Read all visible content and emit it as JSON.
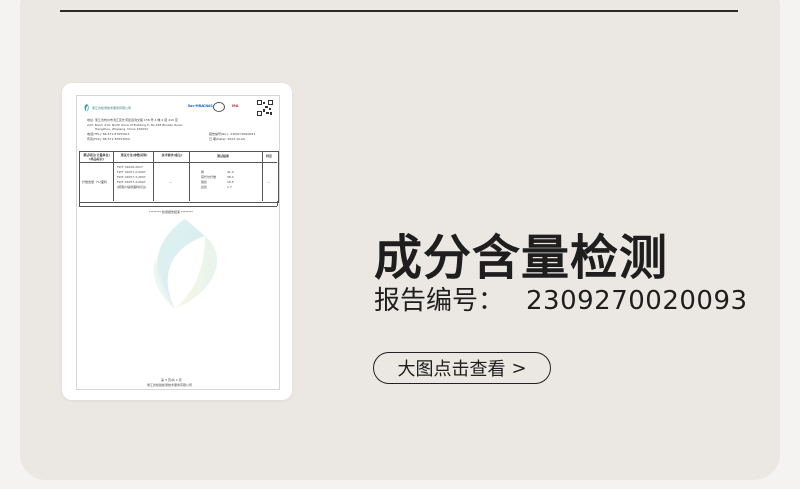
{
  "main": {
    "title": "成分含量检测",
    "report_label": "报告编号：",
    "report_number": "2309270020093",
    "view_button_label": "大图点击查看",
    "view_button_chevron": ">"
  },
  "report_image": {
    "header_org": "浙江省检测技术服务有限公司",
    "seal_labels": [
      "ilac-MRA",
      "CNAS",
      "MA"
    ],
    "address_line": "地址: 浙江省杭州市滨江区长河街道滨文路 158 号 4 幢 4 层 410 室",
    "address_en_1": "Add: Room 410, North Zone of Building 4, No.158 Binwen Road,",
    "address_en_2": "Hangzhou, Zhejiang, China        310052",
    "tel": "电话(TEL): 86-571-87653011",
    "fax": "传真(FAX): 86-571-87653050",
    "report_no": "报告编号(No.): 2309270020093",
    "date": "日  期(Date): 2023-10-09",
    "table_headers": [
      "测试项目(计量单位)(样品标识)",
      "测试方法(参数说明)",
      "技术要求(备注)",
      "测试结果",
      "判定"
    ],
    "row_item": "纤维含量（%）",
    "row_sample": "面料",
    "methods": [
      "FZ/T 01026-2017",
      "FZ/T 01057.2-2007",
      "FZ/T 01057.3-2007",
      "FZ/T 01057.4-2007",
      "(按客户提供面料标注)"
    ],
    "requirement": "—",
    "results": [
      {
        "name": "棉",
        "value": "41.4"
      },
      {
        "name": "莫代尔纤维",
        "value": "38.4"
      },
      {
        "name": "锦纶",
        "value": "18.5"
      },
      {
        "name": "氨纶",
        "value": "1.7"
      }
    ],
    "judgement": "—",
    "end_note": "******** 检测报告结束 ********",
    "page_info": "第 3 页/共 4 页",
    "footer_org": "浙江省检验检测技术服务有限公司"
  }
}
